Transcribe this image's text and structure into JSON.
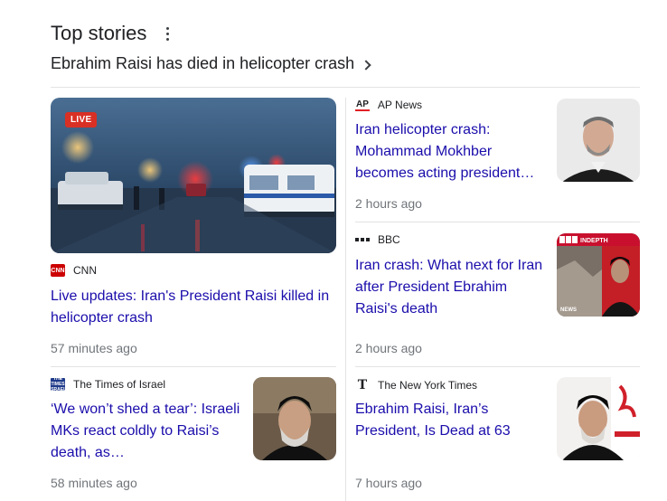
{
  "section": {
    "title": "Top stories",
    "topic": "Ebrahim Raisi has died in helicopter crash"
  },
  "stories": {
    "cnn": {
      "source": "CNN",
      "headline": "Live updates: Iran's President Raisi killed in helicopter crash",
      "time": "57 minutes ago",
      "badge": "LIVE",
      "logo_text": "CNN"
    },
    "ap": {
      "source": "AP News",
      "headline": "Iran helicopter crash: Mohammad Mokhber becomes acting president…",
      "time": "2 hours ago",
      "logo_text": "AP"
    },
    "bbc": {
      "source": "BBC",
      "headline": "Iran crash: What next for Iran after President Ebrahim Raisi's death",
      "time": "2 hours ago",
      "thumb_banner": "INDEPTH",
      "thumb_logo": "BBC",
      "thumb_footer": "NEWS"
    },
    "toi": {
      "source": "The Times of Israel",
      "headline": "‘We won’t shed a tear’: Israeli MKs react coldly to Raisi’s death, as…",
      "time": "58 minutes ago",
      "logo_text": "THE TIMES ISRAEL"
    },
    "nyt": {
      "source": "The New York Times",
      "headline": "Ebrahim Raisi, Iran’s President, Is Dead at 63",
      "time": "7 hours ago",
      "logo_text": "T"
    }
  },
  "colors": {
    "link": "#1a0dab",
    "meta": "#70757a",
    "divider": "#e3e3e3",
    "live_badge": "#d93025"
  },
  "icons": {
    "menu": "kebab-vertical",
    "topic_arrow": "chevron-right"
  }
}
